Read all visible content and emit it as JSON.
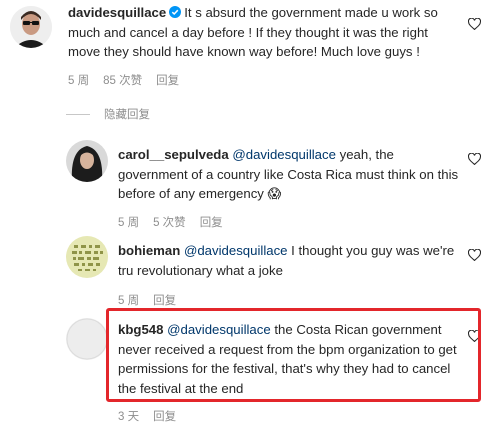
{
  "comments": [
    {
      "username": "davidesquillace",
      "verified": true,
      "text": "It s absurd the government made u work so much and cancel a day before ! If they thought it was the right move they should have known way before! Much love guys !",
      "time": "5 周",
      "likes": "85 次赞",
      "reply": "回复"
    },
    {
      "username": "carol__sepulveda",
      "mention": "@davidesquillace",
      "text": " yeah, the government of a country like Costa Rica must think on this before of any emergency 😱",
      "time": "5 周",
      "likes": "5 次赞",
      "reply": "回复"
    },
    {
      "username": "bohieman",
      "mention": "@davidesquillace",
      "text": " I thought you guy was we're tru revolutionary what a joke",
      "time": "5 周",
      "likes": "",
      "reply": "回复"
    },
    {
      "username": "kbg548",
      "mention": "@davidesquillace",
      "text": " the Costa Rican government never received a request from the bpm organization to get permissions for the festival, that's why they had to cancel the festival at the end",
      "time": "3 天",
      "likes": "",
      "reply": "回复"
    }
  ],
  "hide_replies_label": "隐藏回复",
  "colors": {
    "highlight": "#e3262b",
    "mention": "#00376b",
    "meta": "#8e8e8e",
    "verified": "#0095f6"
  },
  "icons": [
    "verified-badge-icon",
    "heart-icon"
  ]
}
